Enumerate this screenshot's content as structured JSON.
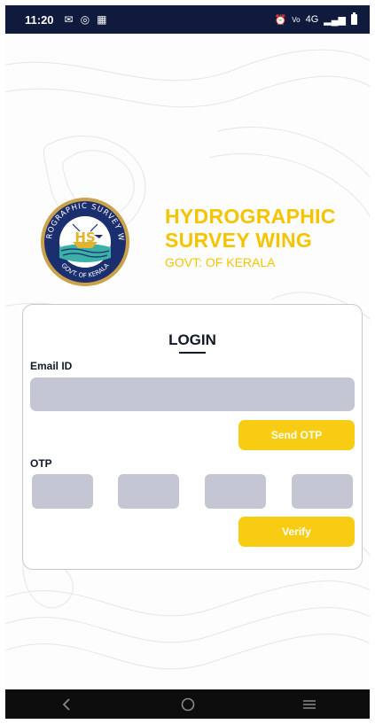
{
  "status_bar": {
    "time": "11:20",
    "left_icons": [
      "gmail-icon",
      "instagram-icon",
      "gallery-icon"
    ],
    "right_text": "4G",
    "right_icons": [
      "alarm-icon",
      "volte-icon",
      "signal-icon",
      "battery-icon"
    ]
  },
  "brand": {
    "title_line1": "HYDROGRAPHIC",
    "title_line2": "SURVEY WING",
    "subtitle": "GOVT: OF KERALA",
    "seal_top_text": "HYDROGRAPHIC SURVEY WING",
    "seal_bottom_text": "GOVT. OF KERALA",
    "seal_center_text": "HS",
    "color": "#f5c400"
  },
  "login": {
    "title": "LOGIN",
    "email_label": "Email ID",
    "email_value": "",
    "send_otp_label": "Send OTP",
    "otp_label": "OTP",
    "otp_digits": [
      "",
      "",
      "",
      ""
    ],
    "verify_label": "Verify"
  },
  "nav_bar": {
    "icons": [
      "back-icon",
      "home-icon",
      "recents-icon"
    ]
  },
  "colors": {
    "status_bar": "#101a3d",
    "accent": "#f7cc12",
    "input_fill": "#c5c6d4"
  }
}
